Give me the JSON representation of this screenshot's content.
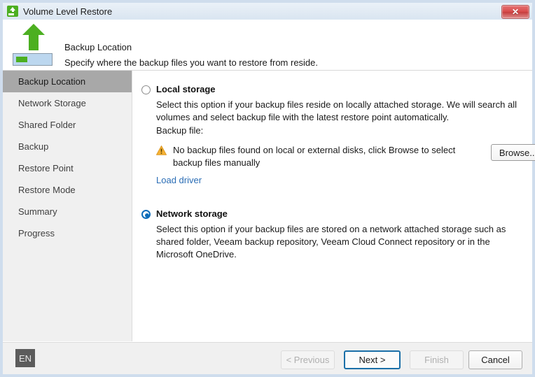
{
  "window": {
    "title": "Volume Level Restore",
    "title_icon": "volume-restore-icon",
    "close_label": "✕"
  },
  "header": {
    "icon": "green-up-arrow-volume-icon",
    "title": "Backup Location",
    "subtitle": "Specify where the backup files you want to restore from reside."
  },
  "sidebar": {
    "items": [
      {
        "label": "Backup Location",
        "selected": true
      },
      {
        "label": "Network Storage",
        "selected": false
      },
      {
        "label": "Shared Folder",
        "selected": false
      },
      {
        "label": "Backup",
        "selected": false
      },
      {
        "label": "Restore Point",
        "selected": false
      },
      {
        "label": "Restore Mode",
        "selected": false
      },
      {
        "label": "Summary",
        "selected": false
      },
      {
        "label": "Progress",
        "selected": false
      }
    ]
  },
  "main": {
    "local_storage": {
      "label": "Local storage",
      "selected": false,
      "description": "Select this option if your backup files reside on locally attached storage. We will search all volumes and select backup file with the latest restore point automatically.",
      "backup_file_label": "Backup file:",
      "warning_icon": "warning-triangle-icon",
      "warning_text": "No backup files found on local or external disks, click Browse to select backup files manually",
      "browse_label": "Browse...",
      "load_driver_label": "Load driver"
    },
    "network_storage": {
      "label": "Network storage",
      "selected": true,
      "description": "Select this option if your backup files are stored on a network attached storage such as shared folder, Veeam backup repository, Veeam Cloud Connect repository or in the Microsoft OneDrive."
    }
  },
  "footer": {
    "language": "EN",
    "buttons": [
      {
        "label": "< Previous",
        "state": "disabled"
      },
      {
        "label": "Next >",
        "state": "default"
      },
      {
        "label": "Finish",
        "state": "disabled"
      },
      {
        "label": "Cancel",
        "state": "normal"
      }
    ]
  },
  "colors": {
    "accent": "#0d6cb9",
    "brand_green": "#4caf21",
    "warning": "#f5a623",
    "link": "#2a6db5",
    "close_red": "#d84b4b"
  }
}
